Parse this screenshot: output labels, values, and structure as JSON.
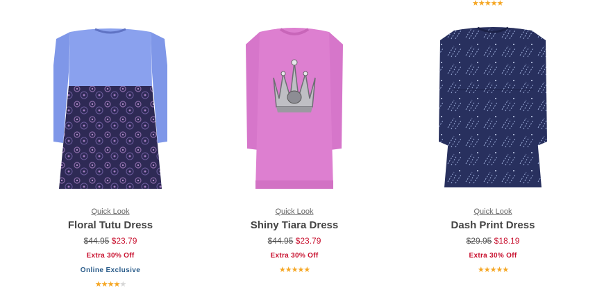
{
  "top_rating": {
    "filled": 5,
    "total": 5
  },
  "products": [
    {
      "quick_look": "Quick Look",
      "name": "Floral Tutu Dress",
      "original_price": "$44.95",
      "sale_price": "$23.79",
      "promo": "Extra 30% Off",
      "badge": "Online Exclusive",
      "rating": {
        "filled": 4,
        "total": 5
      },
      "colors": {
        "top": "#7f97e8",
        "skirt": "#2e2a55"
      }
    },
    {
      "quick_look": "Quick Look",
      "name": "Shiny Tiara Dress",
      "original_price": "$44.95",
      "sale_price": "$23.79",
      "promo": "Extra 30% Off",
      "badge": "",
      "rating": {
        "filled": 5,
        "total": 5
      },
      "colors": {
        "body": "#dd7fd0"
      }
    },
    {
      "quick_look": "Quick Look",
      "name": "Dash Print Dress",
      "original_price": "$29.95",
      "sale_price": "$18.19",
      "promo": "Extra 30% Off",
      "badge": "",
      "rating": {
        "filled": 5,
        "total": 5
      },
      "colors": {
        "body": "#28305e"
      }
    }
  ]
}
